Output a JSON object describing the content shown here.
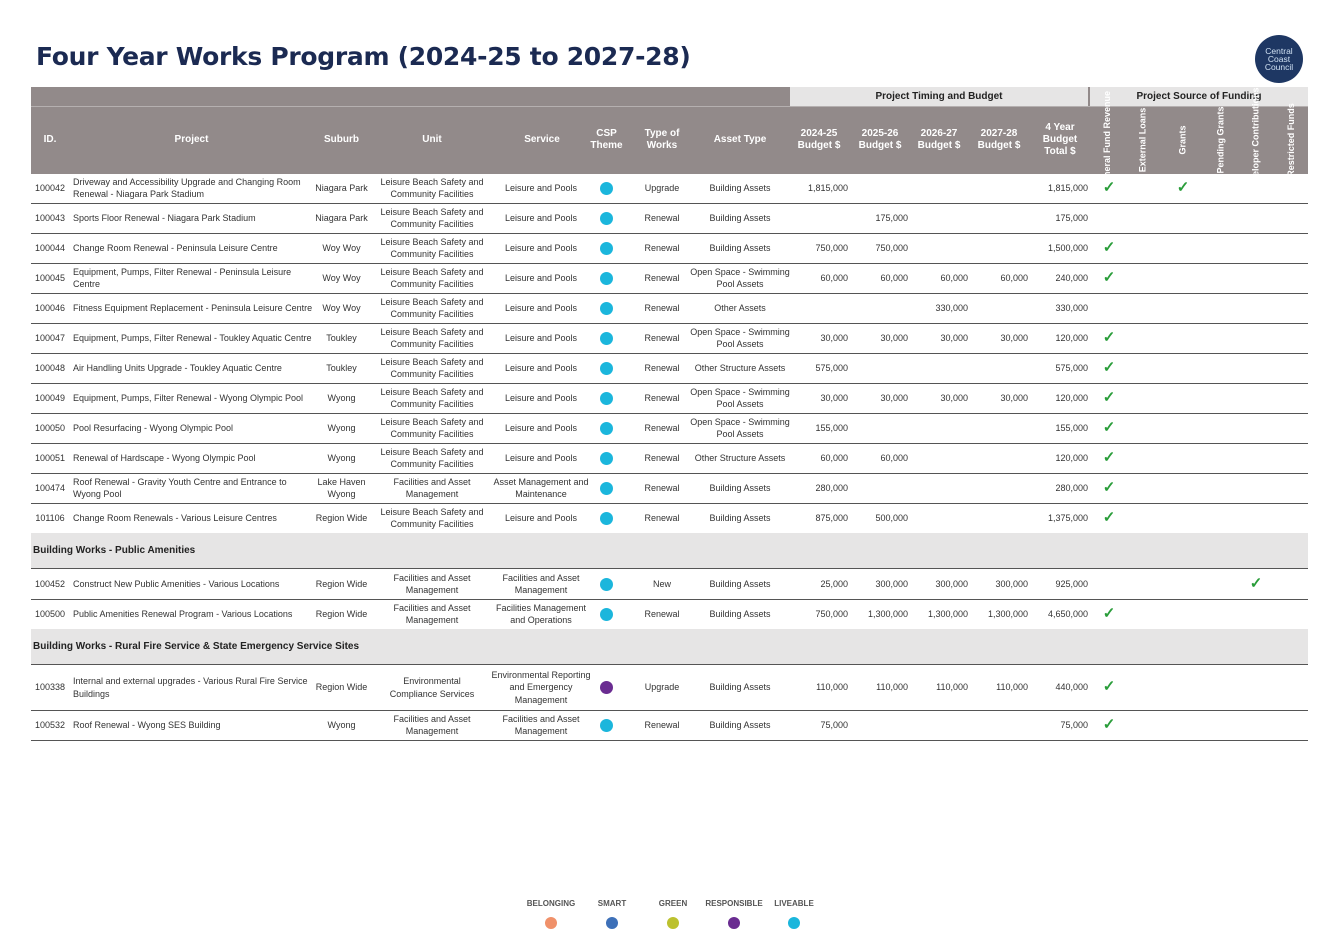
{
  "title": "Four Year Works Program (2024-25 to 2027-28)",
  "logo": {
    "lines": [
      "Central",
      "Coast",
      "Council"
    ]
  },
  "group_headers": {
    "timing": "Project Timing and Budget",
    "funding": "Project Source of Funding"
  },
  "headers": {
    "id": "ID.",
    "project": "Project",
    "suburb": "Suburb",
    "unit": "Unit",
    "service": "Service",
    "csp": "CSP Theme",
    "type": "Type of Works",
    "asset": "Asset Type",
    "y1": "2024-25 Budget $",
    "y2": "2025-26 Budget $",
    "y3": "2026-27 Budget $",
    "y4": "2027-28 Budget $",
    "total": "4 Year Budget Total $",
    "f_general": "General Fund Revenue",
    "f_loans": "External Loans",
    "f_grants": "Grants",
    "f_pending": "Pending Grants",
    "f_developer": "Developer Contributions",
    "f_restricted": "Restricted Funds"
  },
  "theme_colors": {
    "liveable": "#1bb6dc",
    "responsible": "#6a2c91",
    "belonging": "#f0916a",
    "smart": "#3d70b8",
    "green": "#bcc12e"
  },
  "tick_symbol": "✓",
  "rows": [
    {
      "id": "100042",
      "project": "Driveway and Accessibility Upgrade and Changing Room Renewal - Niagara Park Stadium",
      "suburb": "Niagara Park",
      "unit": "Leisure Beach Safety and Community Facilities",
      "service": "Leisure and Pools",
      "theme": "liveable",
      "type": "Upgrade",
      "asset": "Building Assets",
      "y1": "1,815,000",
      "y2": "",
      "y3": "",
      "y4": "",
      "total": "1,815,000",
      "f": [
        true,
        false,
        true,
        false,
        false,
        false
      ]
    },
    {
      "id": "100043",
      "project": "Sports Floor Renewal - Niagara Park Stadium",
      "suburb": "Niagara Park",
      "unit": "Leisure Beach Safety and Community Facilities",
      "service": "Leisure and Pools",
      "theme": "liveable",
      "type": "Renewal",
      "asset": "Building Assets",
      "y1": "",
      "y2": "175,000",
      "y3": "",
      "y4": "",
      "total": "175,000",
      "f": [
        false,
        false,
        false,
        false,
        false,
        false
      ]
    },
    {
      "id": "100044",
      "project": "Change Room Renewal - Peninsula Leisure Centre",
      "suburb": "Woy Woy",
      "unit": "Leisure Beach Safety and Community Facilities",
      "service": "Leisure and Pools",
      "theme": "liveable",
      "type": "Renewal",
      "asset": "Building Assets",
      "y1": "750,000",
      "y2": "750,000",
      "y3": "",
      "y4": "",
      "total": "1,500,000",
      "f": [
        true,
        false,
        false,
        false,
        false,
        false
      ]
    },
    {
      "id": "100045",
      "project": "Equipment, Pumps, Filter Renewal - Peninsula Leisure Centre",
      "suburb": "Woy Woy",
      "unit": "Leisure Beach Safety and Community Facilities",
      "service": "Leisure and Pools",
      "theme": "liveable",
      "type": "Renewal",
      "asset": "Open Space - Swimming Pool Assets",
      "y1": "60,000",
      "y2": "60,000",
      "y3": "60,000",
      "y4": "60,000",
      "total": "240,000",
      "f": [
        true,
        false,
        false,
        false,
        false,
        false
      ]
    },
    {
      "id": "100046",
      "project": "Fitness Equipment Replacement - Peninsula Leisure Centre",
      "suburb": "Woy Woy",
      "unit": "Leisure Beach Safety and Community Facilities",
      "service": "Leisure and Pools",
      "theme": "liveable",
      "type": "Renewal",
      "asset": "Other Assets",
      "y1": "",
      "y2": "",
      "y3": "330,000",
      "y4": "",
      "total": "330,000",
      "f": [
        false,
        false,
        false,
        false,
        false,
        false
      ]
    },
    {
      "id": "100047",
      "project": "Equipment, Pumps, Filter Renewal - Toukley Aquatic Centre",
      "suburb": "Toukley",
      "unit": "Leisure Beach Safety and Community Facilities",
      "service": "Leisure and Pools",
      "theme": "liveable",
      "type": "Renewal",
      "asset": "Open Space - Swimming Pool Assets",
      "y1": "30,000",
      "y2": "30,000",
      "y3": "30,000",
      "y4": "30,000",
      "total": "120,000",
      "f": [
        true,
        false,
        false,
        false,
        false,
        false
      ]
    },
    {
      "id": "100048",
      "project": "Air Handling Units Upgrade - Toukley Aquatic Centre",
      "suburb": "Toukley",
      "unit": "Leisure Beach Safety and Community Facilities",
      "service": "Leisure and Pools",
      "theme": "liveable",
      "type": "Renewal",
      "asset": "Other Structure Assets",
      "y1": "575,000",
      "y2": "",
      "y3": "",
      "y4": "",
      "total": "575,000",
      "f": [
        true,
        false,
        false,
        false,
        false,
        false
      ]
    },
    {
      "id": "100049",
      "project": "Equipment, Pumps, Filter Renewal - Wyong Olympic Pool",
      "suburb": "Wyong",
      "unit": "Leisure Beach Safety and Community Facilities",
      "service": "Leisure and Pools",
      "theme": "liveable",
      "type": "Renewal",
      "asset": "Open Space - Swimming Pool Assets",
      "y1": "30,000",
      "y2": "30,000",
      "y3": "30,000",
      "y4": "30,000",
      "total": "120,000",
      "f": [
        true,
        false,
        false,
        false,
        false,
        false
      ]
    },
    {
      "id": "100050",
      "project": "Pool Resurfacing - Wyong Olympic Pool",
      "suburb": "Wyong",
      "unit": "Leisure Beach Safety and Community Facilities",
      "service": "Leisure and Pools",
      "theme": "liveable",
      "type": "Renewal",
      "asset": "Open Space - Swimming Pool Assets",
      "y1": "155,000",
      "y2": "",
      "y3": "",
      "y4": "",
      "total": "155,000",
      "f": [
        true,
        false,
        false,
        false,
        false,
        false
      ]
    },
    {
      "id": "100051",
      "project": "Renewal of Hardscape - Wyong Olympic Pool",
      "suburb": "Wyong",
      "unit": "Leisure Beach Safety and Community Facilities",
      "service": "Leisure and Pools",
      "theme": "liveable",
      "type": "Renewal",
      "asset": "Other Structure Assets",
      "y1": "60,000",
      "y2": "60,000",
      "y3": "",
      "y4": "",
      "total": "120,000",
      "f": [
        true,
        false,
        false,
        false,
        false,
        false
      ]
    },
    {
      "id": "100474",
      "project": "Roof Renewal - Gravity Youth Centre and Entrance to Wyong Pool",
      "suburb": "Lake Haven Wyong",
      "unit": "Facilities and Asset Management",
      "service": "Asset Management and Maintenance",
      "theme": "liveable",
      "type": "Renewal",
      "asset": "Building Assets",
      "y1": "280,000",
      "y2": "",
      "y3": "",
      "y4": "",
      "total": "280,000",
      "f": [
        true,
        false,
        false,
        false,
        false,
        false
      ]
    },
    {
      "id": "101106",
      "project": "Change Room Renewals - Various Leisure Centres",
      "suburb": "Region Wide",
      "unit": "Leisure Beach Safety and Community Facilities",
      "service": "Leisure and Pools",
      "theme": "liveable",
      "type": "Renewal",
      "asset": "Building Assets",
      "y1": "875,000",
      "y2": "500,000",
      "y3": "",
      "y4": "",
      "total": "1,375,000",
      "f": [
        true,
        false,
        false,
        false,
        false,
        false
      ]
    },
    {
      "section": "Building Works - Public Amenities"
    },
    {
      "id": "100452",
      "project": "Construct New Public Amenities - Various Locations",
      "suburb": "Region Wide",
      "unit": "Facilities and Asset Management",
      "service": "Facilities and Asset Management",
      "theme": "liveable",
      "type": "New",
      "asset": "Building Assets",
      "y1": "25,000",
      "y2": "300,000",
      "y3": "300,000",
      "y4": "300,000",
      "total": "925,000",
      "f": [
        false,
        false,
        false,
        false,
        true,
        false
      ]
    },
    {
      "id": "100500",
      "project": "Public Amenities Renewal Program - Various Locations",
      "suburb": "Region Wide",
      "unit": "Facilities and Asset Management",
      "service": "Facilities Management and Operations",
      "theme": "liveable",
      "type": "Renewal",
      "asset": "Building Assets",
      "y1": "750,000",
      "y2": "1,300,000",
      "y3": "1,300,000",
      "y4": "1,300,000",
      "total": "4,650,000",
      "f": [
        true,
        false,
        false,
        false,
        false,
        false
      ]
    },
    {
      "section": "Building Works - Rural Fire Service & State Emergency Service Sites"
    },
    {
      "id": "100338",
      "project": "Internal and external upgrades - Various Rural Fire Service Buildings",
      "suburb": "Region Wide",
      "unit": "Environmental Compliance Services",
      "service": "Environmental Reporting and Emergency Management",
      "theme": "responsible",
      "type": "Upgrade",
      "asset": "Building Assets",
      "y1": "110,000",
      "y2": "110,000",
      "y3": "110,000",
      "y4": "110,000",
      "total": "440,000",
      "f": [
        true,
        false,
        false,
        false,
        false,
        false
      ]
    },
    {
      "id": "100532",
      "project": "Roof Renewal - Wyong SES Building",
      "suburb": "Wyong",
      "unit": "Facilities and Asset Management",
      "service": "Facilities and Asset Management",
      "theme": "liveable",
      "type": "Renewal",
      "asset": "Building Assets",
      "y1": "75,000",
      "y2": "",
      "y3": "",
      "y4": "",
      "total": "75,000",
      "f": [
        true,
        false,
        false,
        false,
        false,
        false
      ]
    }
  ],
  "legend": [
    {
      "label": "BELONGING",
      "color": "#f0916a"
    },
    {
      "label": "SMART",
      "color": "#3d70b8"
    },
    {
      "label": "GREEN",
      "color": "#bcc12e"
    },
    {
      "label": "RESPONSIBLE",
      "color": "#6a2c91"
    },
    {
      "label": "LIVEABLE",
      "color": "#1bb6dc"
    }
  ]
}
